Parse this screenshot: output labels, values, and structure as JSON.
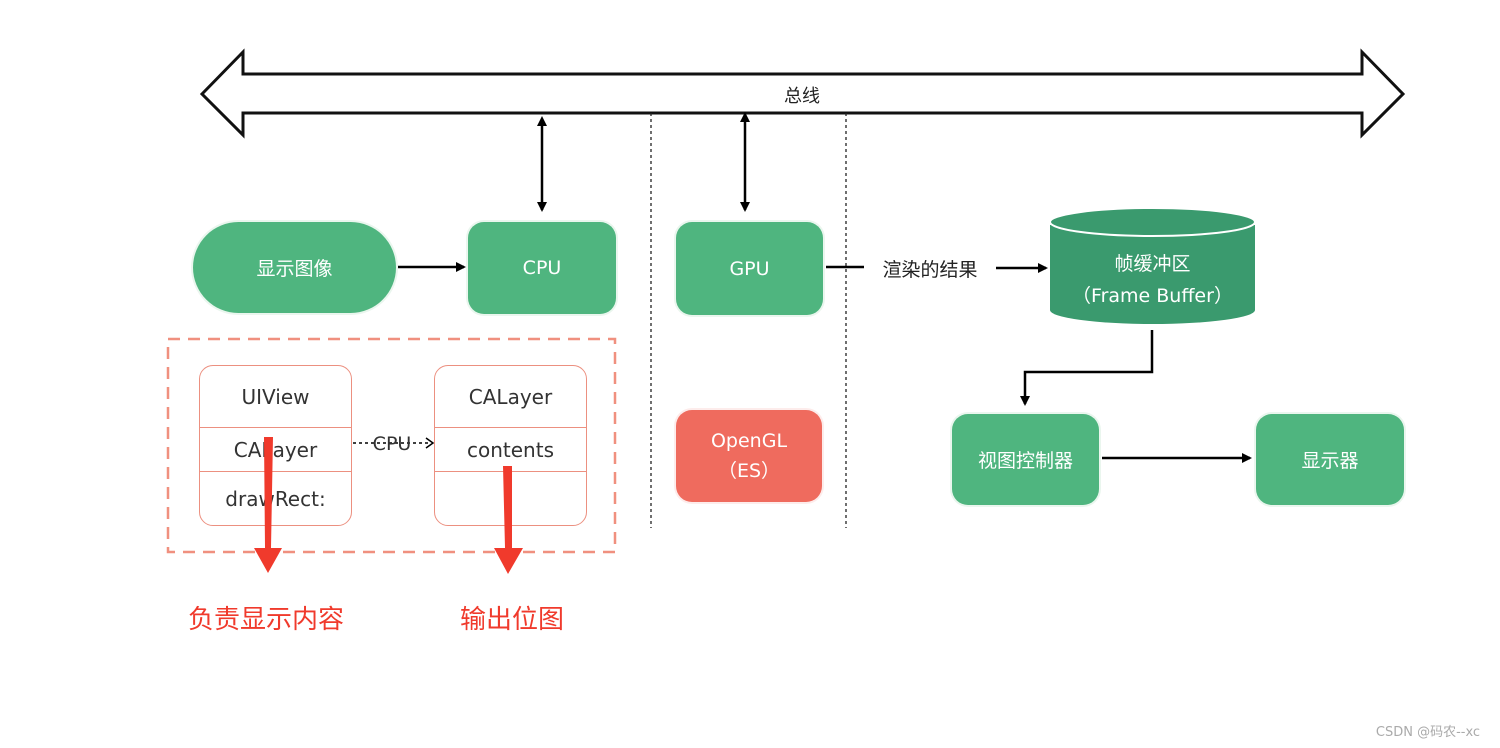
{
  "bus": {
    "label": "总线"
  },
  "nodes": {
    "display_image": "显示图像",
    "cpu": "CPU",
    "gpu": "GPU",
    "render_result": "渲染的结果",
    "frame_buffer_line1": "帧缓冲区",
    "frame_buffer_line2": "（Frame Buffer）",
    "view_controller": "视图控制器",
    "display": "显示器",
    "opengl_line1": "OpenGL",
    "opengl_line2": "（ES）"
  },
  "uiview_box": {
    "rows": [
      "UIView",
      "CALayer",
      "drawRect:"
    ]
  },
  "calayer_box": {
    "rows": [
      "CALayer",
      "contents",
      ""
    ]
  },
  "cpu_arrow_label": "CPU",
  "annotations": {
    "left": "负责显示内容",
    "right": "输出位图"
  },
  "watermark": "CSDN @码农--xc",
  "colors": {
    "green": "#4fb57f",
    "dark_green": "#3a9a6e",
    "red_box": "#ef6b5e",
    "annotation_red": "#f03a2c",
    "dash_border": "#f0907f"
  }
}
